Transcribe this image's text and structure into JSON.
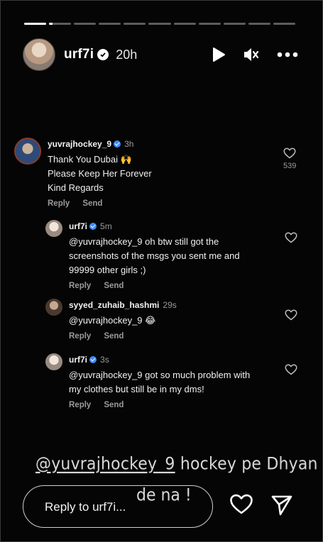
{
  "story": {
    "progress_fraction": [
      1.0,
      0.15,
      0,
      0,
      0,
      0,
      0,
      0,
      0,
      0,
      0
    ]
  },
  "header": {
    "username": "urf7i",
    "time": "20h",
    "icons": [
      "play-icon",
      "mute-icon",
      "more-icon"
    ]
  },
  "comments": [
    {
      "user": "yuvrajhockey_9",
      "age": "3h",
      "verified": true,
      "text_lines": [
        "Thank You Dubai 🙌",
        "Please Keep Her Forever",
        "Kind Regards"
      ],
      "like_count": "539",
      "reply_label": "Reply",
      "send_label": "Send"
    },
    {
      "user": "urf7i",
      "age": "5m",
      "verified": true,
      "text_lines": [
        "@yuvrajhockey_9 oh btw still got the",
        "screenshots of the msgs you sent me and",
        "99999 other girls ;)"
      ],
      "reply_label": "Reply",
      "send_label": "Send"
    },
    {
      "user": "syyed_zuhaib_hashmi",
      "age": "29s",
      "verified": false,
      "text_lines": [
        "@yuvrajhockey_9 😂"
      ],
      "reply_label": "Reply",
      "send_label": "Send"
    },
    {
      "user": "urf7i",
      "age": "3s",
      "verified": true,
      "text_lines": [
        "@yuvrajhockey_9 got so much problem with",
        "my clothes but still be in my dms!"
      ],
      "reply_label": "Reply",
      "send_label": "Send"
    }
  ],
  "overlay": {
    "mention": "@yuvrajhockey_9",
    "line1_rest": "hockey pe Dhyan",
    "line2": "de na !"
  },
  "reply_bar": {
    "placeholder": "Reply to urf7i..."
  }
}
